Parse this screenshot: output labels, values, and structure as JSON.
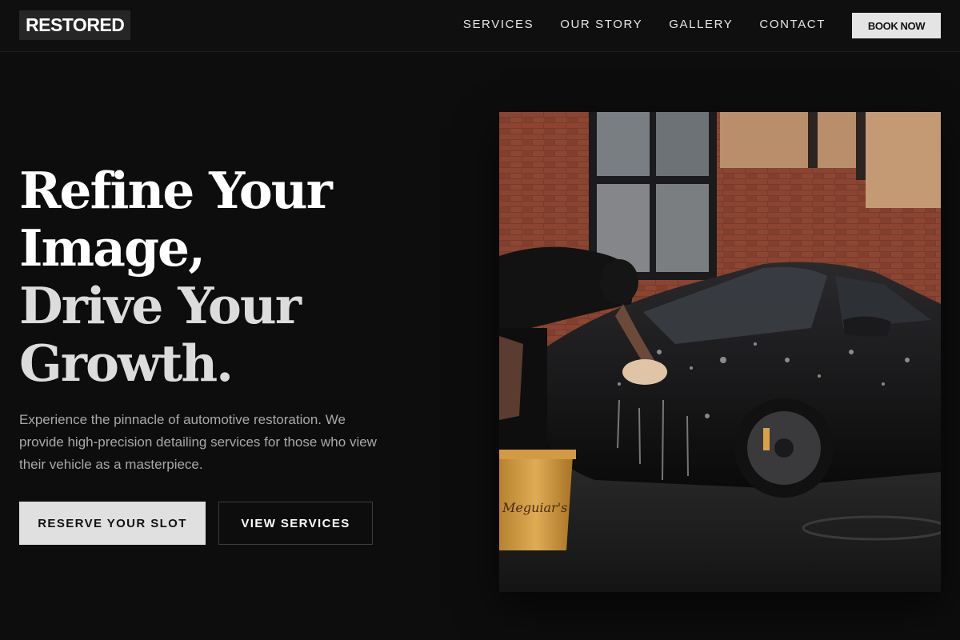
{
  "nav": {
    "logo": "RESTORED",
    "links": [
      "SERVICES",
      "OUR STORY",
      "GALLERY",
      "CONTACT"
    ],
    "cta": "BOOK NOW"
  },
  "hero": {
    "title_line1": "Refine Your",
    "title_line2": "Image,",
    "title_line3": "Drive Your",
    "title_line4": "Growth.",
    "description": "Experience the pinnacle of automotive restoration. We provide high-precision detailing services for those who view their vehicle as a masterpiece.",
    "primary_button": "RESERVE YOUR SLOT",
    "secondary_button": "VIEW SERVICES",
    "bucket_label": "Meguiar's"
  },
  "colors": {
    "background": "#0d0d0d",
    "accent_button": "#e0e0e0",
    "text_muted": "#a9a9a9",
    "brick": "#7a3a2a",
    "bucket": "#d9a24a"
  }
}
